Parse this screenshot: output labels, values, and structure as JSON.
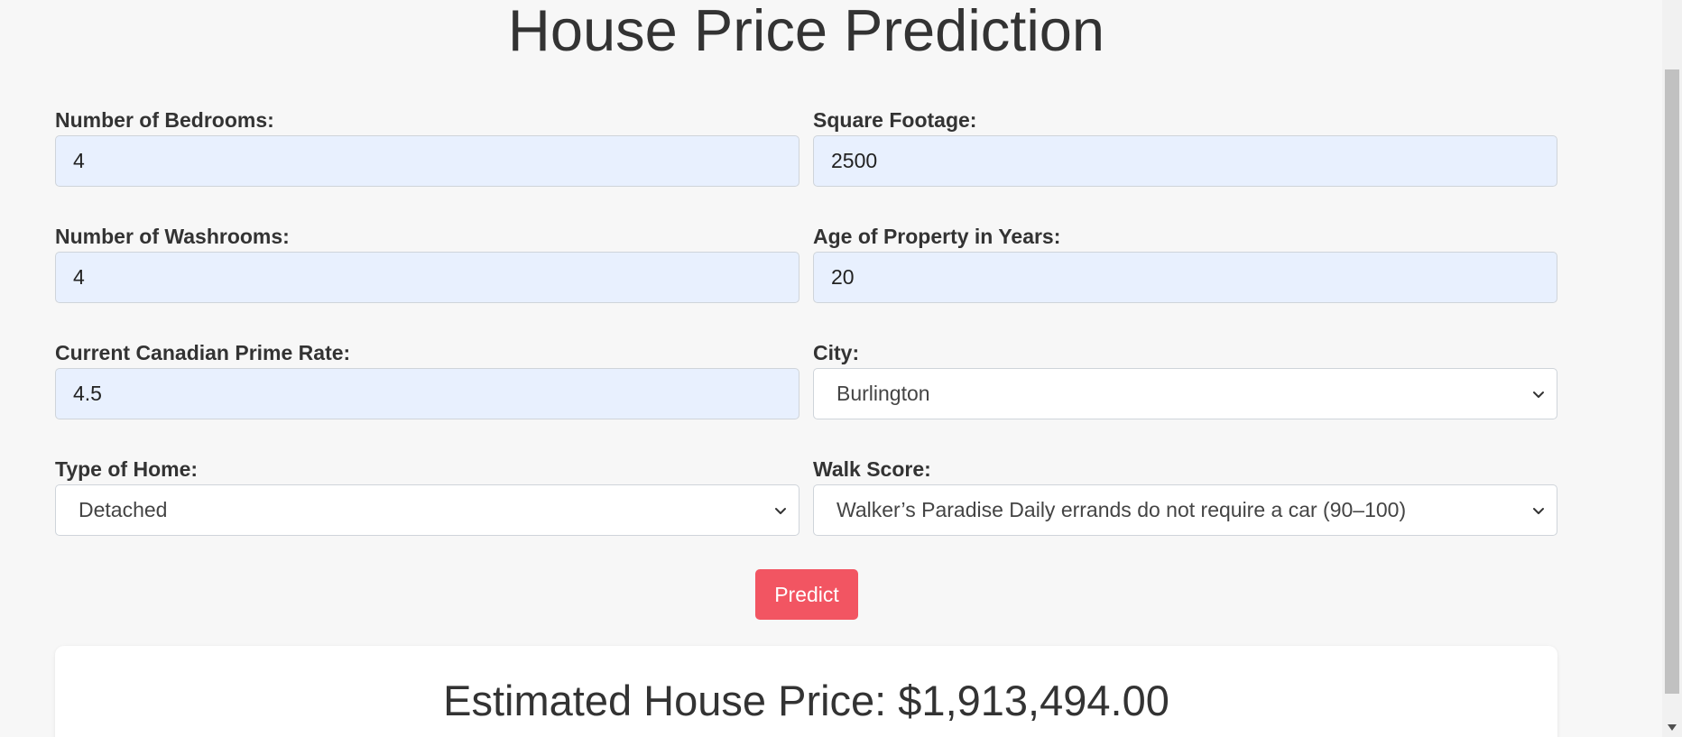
{
  "page_title": "House Price Prediction",
  "form": {
    "bedrooms": {
      "label": "Number of Bedrooms:",
      "value": "4"
    },
    "square_footage": {
      "label": "Square Footage:",
      "value": "2500"
    },
    "washrooms": {
      "label": "Number of Washrooms:",
      "value": "4"
    },
    "age": {
      "label": "Age of Property in Years:",
      "value": "20"
    },
    "prime_rate": {
      "label": "Current Canadian Prime Rate:",
      "value": "4.5"
    },
    "city": {
      "label": "City:",
      "selected": "Burlington"
    },
    "home_type": {
      "label": "Type of Home:",
      "selected": "Detached"
    },
    "walk_score": {
      "label": "Walk Score:",
      "selected": "Walker’s Paradise Daily errands do not require a car (90–100)"
    }
  },
  "predict_button": "Predict",
  "result": {
    "text": "Estimated House Price: $1,913,494.00"
  },
  "colors": {
    "accent_button": "#f25562",
    "input_autofill_bg": "#e8f0fe",
    "page_bg": "#f7f7f7"
  },
  "icons": {
    "select_arrow": "chevron-down-icon"
  }
}
